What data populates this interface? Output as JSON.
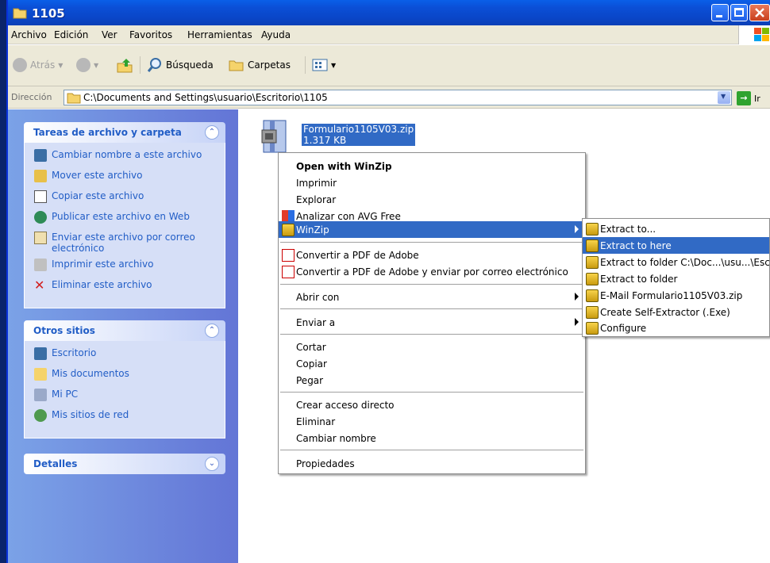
{
  "window": {
    "title": "1105"
  },
  "menubar": {
    "items": [
      "Archivo",
      "Edición",
      "Ver",
      "Favoritos",
      "Herramientas",
      "Ayuda"
    ]
  },
  "toolbar": {
    "back": "Atrás",
    "search": "Búsqueda",
    "folders": "Carpetas"
  },
  "address": {
    "label": "Dirección",
    "path": "C:\\Documents and Settings\\usuario\\Escritorio\\1105",
    "go": "Ir"
  },
  "left_panel": {
    "file_tasks": {
      "title": "Tareas de archivo y carpeta",
      "items": [
        {
          "label": "Cambiar nombre a este archivo",
          "icon": "rename-icon"
        },
        {
          "label": "Mover este archivo",
          "icon": "move-icon"
        },
        {
          "label": "Copiar este archivo",
          "icon": "copy-icon"
        },
        {
          "label": "Publicar este archivo en Web",
          "icon": "publish-web-icon"
        },
        {
          "label": "Enviar este archivo por correo electrónico",
          "icon": "email-icon"
        },
        {
          "label": "Imprimir este archivo",
          "icon": "print-icon"
        },
        {
          "label": "Eliminar este archivo",
          "icon": "delete-icon"
        }
      ]
    },
    "other_places": {
      "title": "Otros sitios",
      "items": [
        {
          "label": "Escritorio",
          "icon": "desktop-icon"
        },
        {
          "label": "Mis documentos",
          "icon": "my-documents-icon"
        },
        {
          "label": "Mi PC",
          "icon": "my-computer-icon"
        },
        {
          "label": "Mis sitios de red",
          "icon": "network-places-icon"
        }
      ]
    },
    "details": {
      "title": "Detalles"
    }
  },
  "file": {
    "name": "Formulario1105V03.zip",
    "size": "1.317 KB"
  },
  "context_menu": {
    "open_winzip": "Open with WinZip",
    "print": "Imprimir",
    "explore": "Explorar",
    "avg": "Analizar con AVG Free",
    "winzip": "WinZip",
    "pdf": "Convertir a PDF de Adobe",
    "pdf_email": "Convertir a PDF de Adobe y enviar por correo electrónico",
    "open_with": "Abrir con",
    "send_to": "Enviar a",
    "cut": "Cortar",
    "copy": "Copiar",
    "paste": "Pegar",
    "shortcut": "Crear acceso directo",
    "delete": "Eliminar",
    "rename": "Cambiar nombre",
    "properties": "Propiedades"
  },
  "winzip_submenu": {
    "items": [
      "Extract to...",
      "Extract to here",
      "Extract to folder C:\\Doc...\\usu...\\Esc",
      "Extract to folder",
      "E-Mail Formulario1105V03.zip",
      "Create Self-Extractor (.Exe)",
      "Configure"
    ],
    "highlighted": "Extract to here"
  },
  "colors": {
    "selection": "#316ac5",
    "task_link": "#215dc6",
    "titlebar": "#0a4fd6"
  }
}
